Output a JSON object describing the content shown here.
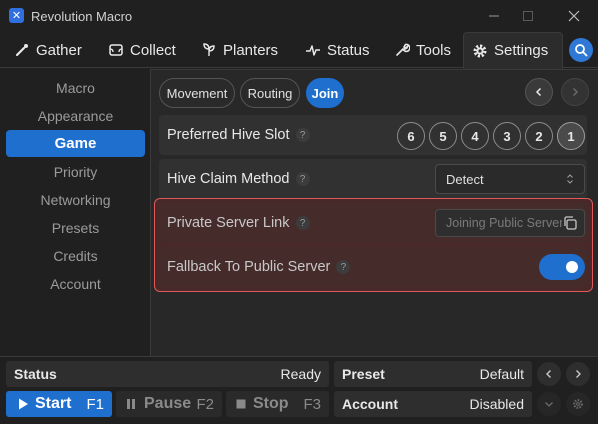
{
  "window": {
    "title": "Revolution Macro",
    "icon_label": "✕"
  },
  "tabs": [
    {
      "label": "Gather",
      "icon": "wand-icon"
    },
    {
      "label": "Collect",
      "icon": "collect-icon"
    },
    {
      "label": "Planters",
      "icon": "planter-icon"
    },
    {
      "label": "Status",
      "icon": "pulse-icon"
    },
    {
      "label": "Tools",
      "icon": "wrench-icon"
    },
    {
      "label": "Settings",
      "icon": "gear-icon",
      "active": true
    }
  ],
  "sidebar": {
    "items": [
      {
        "label": "Macro"
      },
      {
        "label": "Appearance"
      },
      {
        "label": "Game",
        "active": true
      },
      {
        "label": "Priority"
      },
      {
        "label": "Networking"
      },
      {
        "label": "Presets"
      },
      {
        "label": "Credits"
      },
      {
        "label": "Account"
      }
    ]
  },
  "subtabs": [
    {
      "label": "Movement"
    },
    {
      "label": "Routing"
    },
    {
      "label": "Join",
      "active": true
    }
  ],
  "settings": {
    "hive_slot": {
      "label": "Preferred Hive Slot",
      "help": "?",
      "options": [
        "6",
        "5",
        "4",
        "3",
        "2",
        "1"
      ],
      "selected": "1"
    },
    "hive_claim": {
      "label": "Hive Claim Method",
      "help": "?",
      "value": "Detect"
    },
    "private_server": {
      "label": "Private Server Link",
      "help": "?",
      "placeholder": "Joining Public Server"
    },
    "fallback": {
      "label": "Fallback To Public Server",
      "help": "?",
      "enabled": true
    }
  },
  "bottom": {
    "status": {
      "label": "Status",
      "value": "Ready"
    },
    "preset": {
      "label": "Preset",
      "value": "Default"
    },
    "account": {
      "label": "Account",
      "value": "Disabled"
    },
    "start": {
      "label": "Start",
      "key": "F1"
    },
    "pause": {
      "label": "Pause",
      "key": "F2"
    },
    "stop": {
      "label": "Stop",
      "key": "F3"
    }
  },
  "colors": {
    "accent": "#1f6fcf",
    "warning_border": "#e05a5a",
    "background": "#202020",
    "panel": "#282828"
  }
}
